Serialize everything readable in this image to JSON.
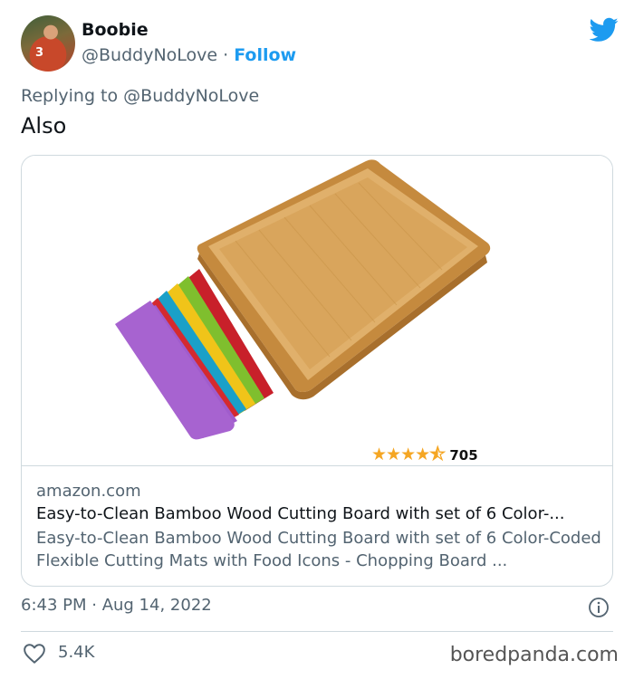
{
  "user": {
    "name": "Boobie",
    "handle": "@BuddyNoLove",
    "separator": " · ",
    "follow_label": "Follow",
    "avatar_jersey_number": "3"
  },
  "reply": {
    "prefix": "Replying to ",
    "mention": "@BuddyNoLove"
  },
  "tweet": {
    "text": "Also",
    "timestamp": "6:43 PM · Aug 14, 2022",
    "likes": "5.4K"
  },
  "card": {
    "rating_stars": "★★★★⯪",
    "rating_count": "705",
    "domain": "amazon.com",
    "title": "Easy-to-Clean Bamboo Wood Cutting Board with set of 6 Color-...",
    "description": "Easy-to-Clean Bamboo Wood Cutting Board with set of 6 Color-Coded Flexible Cutting Mats with Food Icons - Chopping Board ..."
  },
  "watermark": "boredpanda.com",
  "colors": {
    "twitter_blue": "#1d9bf0",
    "text_secondary": "#536471",
    "border": "#cfd9de",
    "star": "#f5a623"
  },
  "icons": [
    "twitter-bird-icon",
    "info-icon",
    "heart-icon"
  ]
}
